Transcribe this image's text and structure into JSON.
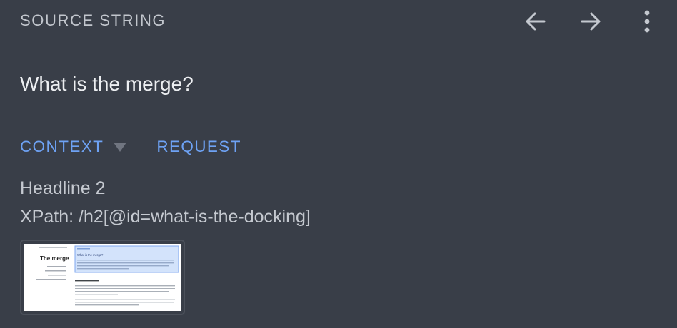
{
  "header": {
    "title": "SOURCE STRING"
  },
  "toolbar": {
    "icons": [
      "arrow-back-icon",
      "arrow-forward-icon",
      "more-vert-icon"
    ]
  },
  "source_string": {
    "text": "What is the merge?"
  },
  "tabs": [
    {
      "label": "CONTEXT",
      "has_dropdown": true
    },
    {
      "label": "REQUEST",
      "has_dropdown": false
    }
  ],
  "context": {
    "element_type": "Headline 2",
    "xpath": "XPath: /h2[@id=what-is-the-docking]"
  },
  "screenshot_thumbnail": {
    "heading_left": "The merge",
    "heading_highlight": "What is the merge?"
  },
  "colors": {
    "background": "#393e48",
    "accent": "#6ea2f4",
    "muted_text": "#c2c6cd",
    "primary_text": "#eceef1"
  }
}
